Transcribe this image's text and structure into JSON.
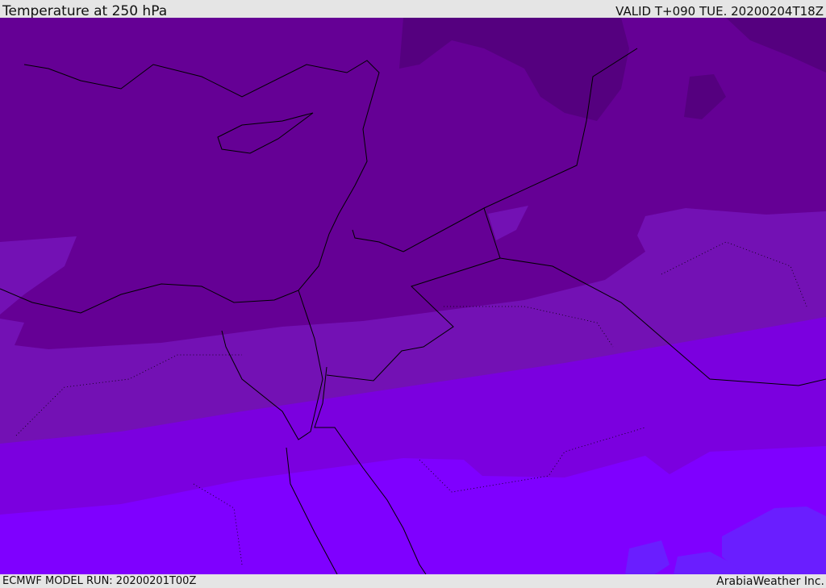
{
  "header": {
    "title": "Temperature at 250 hPa",
    "valid": "VALID T+090 TUE. 20200204T18Z"
  },
  "footer": {
    "model_run": "ECMWF MODEL RUN: 20200201T00Z",
    "credit": "ArabiaWeather Inc."
  },
  "map": {
    "field": "Temperature at 250 hPa",
    "band_colors": [
      "#55007f",
      "#650095",
      "#7311b4",
      "#7b00df",
      "#7f00ff",
      "#6a1eff"
    ],
    "line_color": "#000000"
  }
}
